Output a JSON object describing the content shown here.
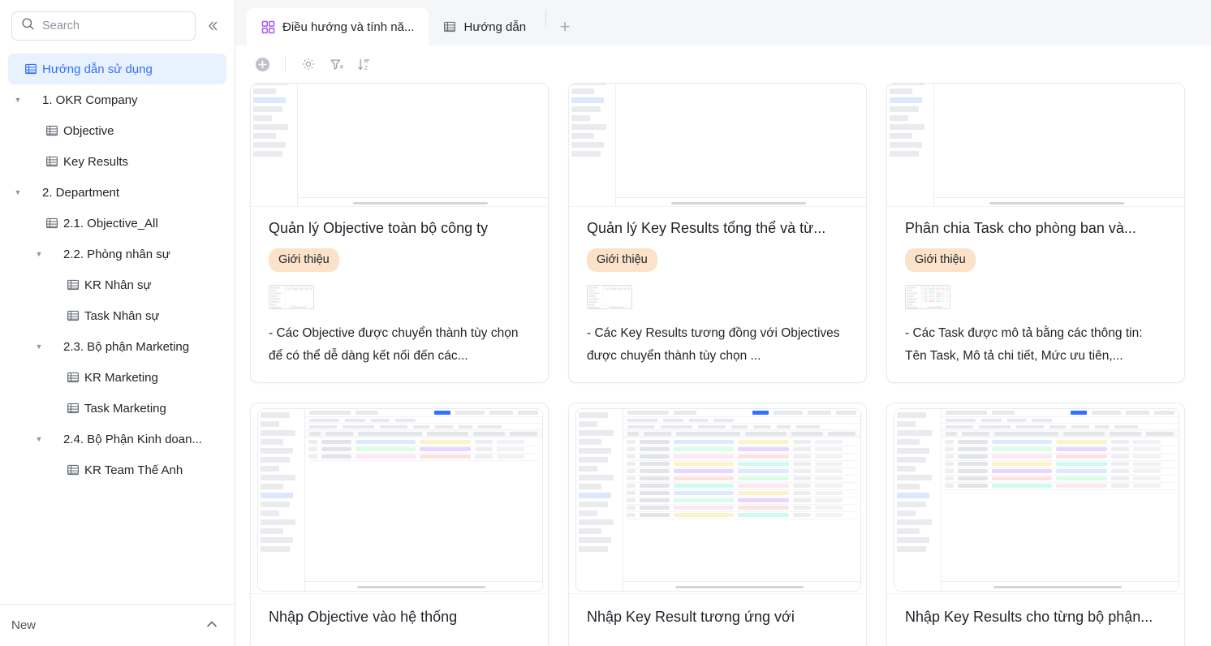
{
  "sidebar": {
    "search": {
      "placeholder": "Search",
      "value": ""
    },
    "collapse_label": "«",
    "items": [
      {
        "label": "Hướng dẫn sử dụng",
        "icon": "table-icon",
        "depth": 0,
        "active": true,
        "caret": ""
      },
      {
        "label": "1. OKR Company",
        "icon": "",
        "depth": 0,
        "active": false,
        "caret": "▼"
      },
      {
        "label": "Objective",
        "icon": "table-icon",
        "depth": 1,
        "active": false,
        "caret": ""
      },
      {
        "label": "Key Results",
        "icon": "table-icon",
        "depth": 1,
        "active": false,
        "caret": ""
      },
      {
        "label": "2. Department",
        "icon": "",
        "depth": 0,
        "active": false,
        "caret": "▼"
      },
      {
        "label": "2.1. Objective_All",
        "icon": "table-icon",
        "depth": 1,
        "active": false,
        "caret": ""
      },
      {
        "label": "2.2. Phòng nhân sự",
        "icon": "",
        "depth": 1,
        "active": false,
        "caret": "▼"
      },
      {
        "label": "KR Nhân sự",
        "icon": "table-icon",
        "depth": 2,
        "active": false,
        "caret": ""
      },
      {
        "label": "Task Nhân sự",
        "icon": "table-icon",
        "depth": 2,
        "active": false,
        "caret": ""
      },
      {
        "label": "2.3. Bộ phận Marketing",
        "icon": "",
        "depth": 1,
        "active": false,
        "caret": "▼"
      },
      {
        "label": "KR Marketing",
        "icon": "table-icon",
        "depth": 2,
        "active": false,
        "caret": ""
      },
      {
        "label": "Task Marketing",
        "icon": "table-icon",
        "depth": 2,
        "active": false,
        "caret": ""
      },
      {
        "label": "2.4. Bộ Phận Kinh doan...",
        "icon": "",
        "depth": 1,
        "active": false,
        "caret": "▼"
      },
      {
        "label": "KR Team Thế Anh",
        "icon": "table-icon",
        "depth": 2,
        "active": false,
        "caret": ""
      }
    ],
    "footer": {
      "label": "New",
      "chevron": "chevron-up-icon"
    }
  },
  "tabs": {
    "items": [
      {
        "label": "Điều hướng và tính nă...",
        "icon": "grid-icon",
        "active": true
      },
      {
        "label": "Hướng dẫn",
        "icon": "table-icon",
        "active": false
      }
    ],
    "add_label": "+"
  },
  "toolbar": {
    "buttons": [
      {
        "name": "add-record-button",
        "icon": "plus-circle-icon"
      },
      {
        "name": "settings-button",
        "icon": "gear-icon"
      },
      {
        "name": "filter-button",
        "icon": "filter-icon"
      },
      {
        "name": "sort-button",
        "icon": "sort-az-icon"
      }
    ]
  },
  "cards": [
    {
      "title": "Quản lý Objective toàn bộ công ty",
      "badge": "Giới thiệu",
      "desc": "- Các Objective được chuyển thành tùy chọn để có thể dễ dàng kết nối đến các...",
      "row": "top"
    },
    {
      "title": "Quản lý Key Results tổng thể và từ...",
      "badge": "Giới thiệu",
      "desc": "- Các Key Results tương đồng với Objectives được chuyển thành tùy chọn ...",
      "row": "top"
    },
    {
      "title": "Phân chia Task cho phòng ban và...",
      "badge": "Giới thiệu",
      "desc": "- Các Task được mô tả bằng các thông tin: Tên Task, Mô tả chi tiết, Mức ưu tiên,...",
      "row": "top"
    },
    {
      "title": "Nhập Objective vào hệ thống",
      "badge": "",
      "desc": "",
      "row": "bottom"
    },
    {
      "title": "Nhập Key Result tương ứng với",
      "badge": "",
      "desc": "",
      "row": "bottom"
    },
    {
      "title": "Nhập Key Results cho từng bộ phận...",
      "badge": "",
      "desc": "",
      "row": "bottom"
    }
  ],
  "colors": {
    "accent_blue": "#3370ff",
    "tab_icon_purple": "#a95ef0",
    "badge_bg": "#fbe2c8",
    "sidebar_active_bg": "#e8f1fe",
    "page_bg": "#f5f6f7"
  }
}
